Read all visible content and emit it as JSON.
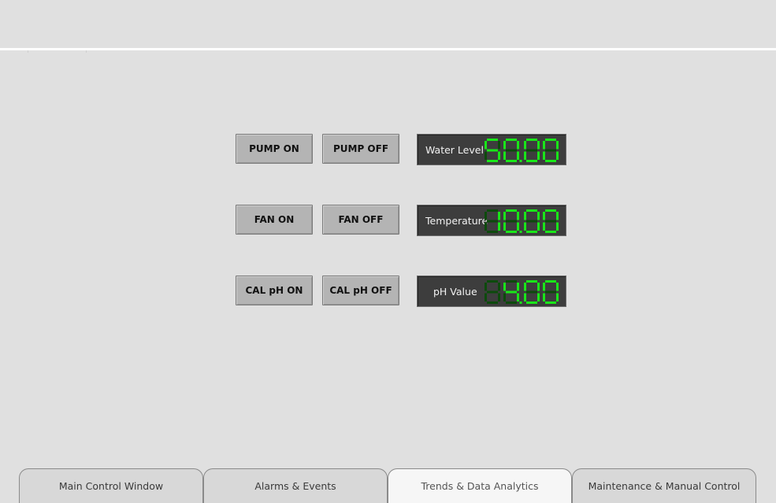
{
  "controls": {
    "pump_on": "PUMP ON",
    "pump_off": "PUMP OFF",
    "fan_on": "FAN ON",
    "fan_off": "FAN OFF",
    "cal_ph_on": "CAL pH ON",
    "cal_ph_off": "CAL pH OFF"
  },
  "displays": [
    {
      "label": "Water Level",
      "value": "50.00"
    },
    {
      "label": "Temperature",
      "value": "10.00"
    },
    {
      "label": "pH Value",
      "value": "4.00"
    }
  ],
  "tabs": [
    {
      "label": "Main Control Window",
      "active": false
    },
    {
      "label": "Alarms & Events",
      "active": false
    },
    {
      "label": "Trends & Data Analytics",
      "active": true
    },
    {
      "label": "Maintenance & Manual Control",
      "active": false
    }
  ],
  "colors": {
    "segment_on": "#19e619",
    "segment_off": "#0c4a0c"
  }
}
